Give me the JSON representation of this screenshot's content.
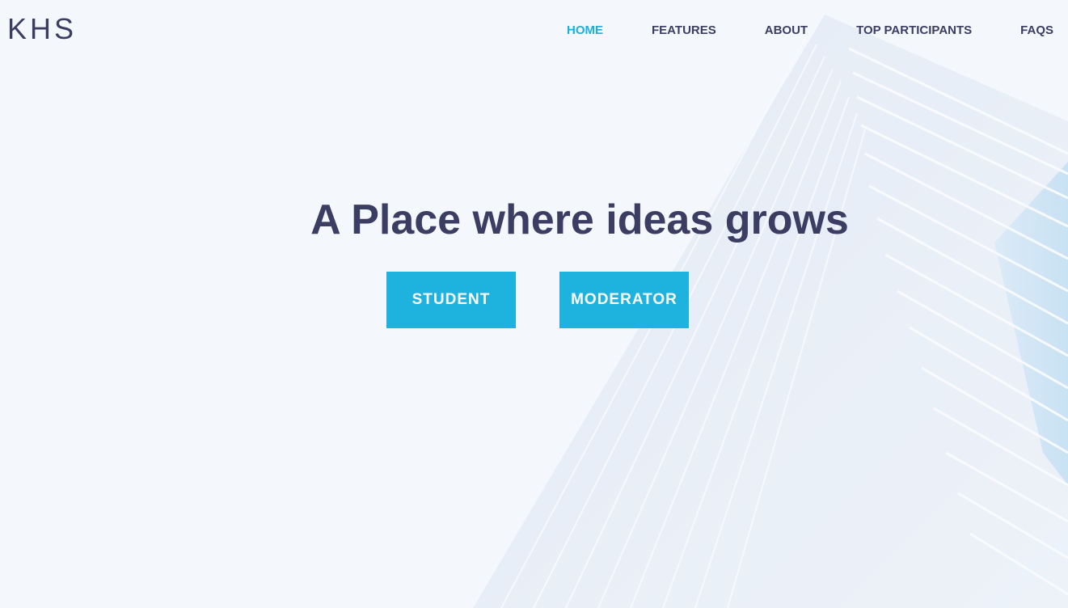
{
  "brand": {
    "logo_text": "KHS"
  },
  "nav": {
    "items": [
      {
        "label": "HOME",
        "active": true
      },
      {
        "label": "FEATURES",
        "active": false
      },
      {
        "label": "ABOUT",
        "active": false
      },
      {
        "label": "TOP PARTICIPANTS",
        "active": false
      },
      {
        "label": "FAQS",
        "active": false
      }
    ]
  },
  "hero": {
    "title": "A Place where ideas grows",
    "buttons": {
      "student": "STUDENT",
      "moderator": "MODERATOR"
    }
  },
  "colors": {
    "accent": "#1eb3de",
    "text_dark": "#3b3d63",
    "background": "#f4f8fd"
  }
}
